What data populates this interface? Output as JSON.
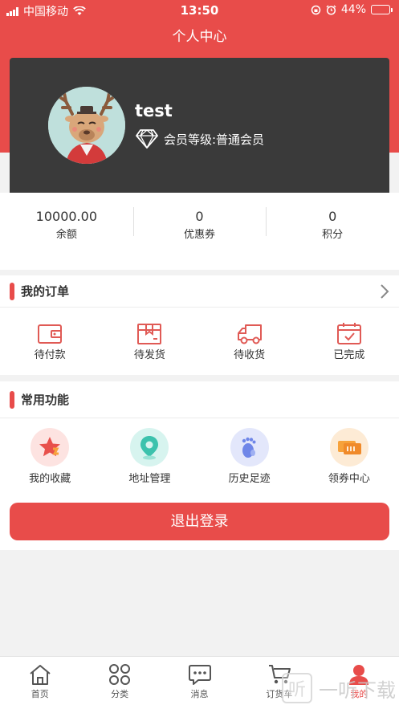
{
  "status_bar": {
    "carrier": "中国移动",
    "time": "13:50",
    "battery": "44%",
    "battery_level": 0.44
  },
  "header": {
    "title": "个人中心"
  },
  "profile": {
    "username": "test",
    "member_level": "会员等级:普通会员"
  },
  "stats": [
    {
      "value": "10000.00",
      "label": "余额"
    },
    {
      "value": "0",
      "label": "优惠券"
    },
    {
      "value": "0",
      "label": "积分"
    }
  ],
  "orders": {
    "title": "我的订单",
    "items": [
      {
        "label": "待付款",
        "icon": "wallet-icon"
      },
      {
        "label": "待发货",
        "icon": "package-icon"
      },
      {
        "label": "待收货",
        "icon": "truck-icon"
      },
      {
        "label": "已完成",
        "icon": "calendar-check-icon"
      }
    ]
  },
  "functions": {
    "title": "常用功能",
    "items": [
      {
        "label": "我的收藏",
        "icon": "star-icon"
      },
      {
        "label": "地址管理",
        "icon": "location-icon"
      },
      {
        "label": "历史足迹",
        "icon": "footprint-icon"
      },
      {
        "label": "领券中心",
        "icon": "coupon-icon"
      }
    ]
  },
  "logout_label": "退出登录",
  "tabbar": {
    "items": [
      {
        "label": "首页",
        "icon": "home-icon"
      },
      {
        "label": "分类",
        "icon": "category-icon"
      },
      {
        "label": "消息",
        "icon": "message-icon"
      },
      {
        "label": "订货车",
        "icon": "cart-icon"
      },
      {
        "label": "我的",
        "icon": "user-icon",
        "active": true
      }
    ]
  },
  "watermark": {
    "text": "一听下载",
    "glyph": "听"
  },
  "colors": {
    "accent": "#e84c4a",
    "card_dark": "#3a3a3a",
    "background": "#f2f2f2"
  }
}
